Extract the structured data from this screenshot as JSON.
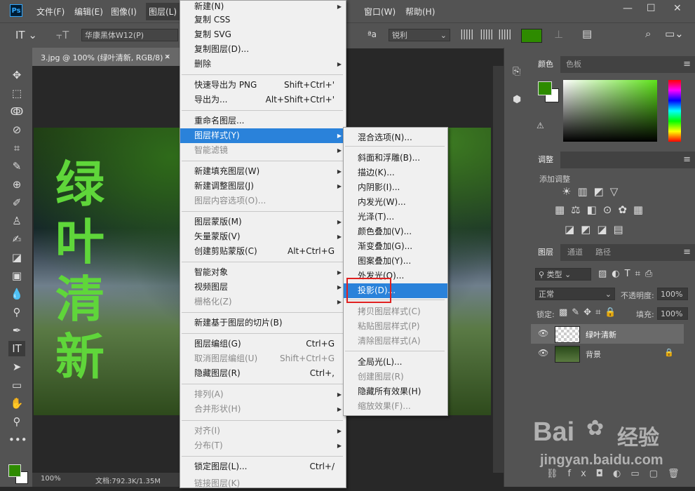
{
  "app": {
    "logo": "Ps"
  },
  "menubar": {
    "items": [
      "文件(F)",
      "编辑(E)",
      "图像(I)",
      "图层(L)",
      "窗口(W)",
      "帮助(H)"
    ]
  },
  "window_controls": {
    "minimize": "—",
    "maximize": "☐",
    "close": "✕"
  },
  "options_bar": {
    "font_family": "华康黑体W12(P)",
    "aa_label": "a",
    "aa_value": "锐利",
    "color": "#2e8b00"
  },
  "document": {
    "tab_title": "3.jpg @ 100% (绿叶清新, RGB/8) *",
    "tab_close": "×",
    "canvas_text": "绿叶清新",
    "zoom": "100%",
    "doc_size": "文档:792.3K/1.35M"
  },
  "layer_menu": {
    "items": [
      {
        "label": "新建(N)",
        "shortcut": "",
        "submenu": true,
        "disabled": false
      },
      {
        "label": "复制 CSS",
        "shortcut": "",
        "submenu": false,
        "disabled": false
      },
      {
        "label": "复制 SVG",
        "shortcut": "",
        "submenu": false,
        "disabled": false
      },
      {
        "label": "复制图层(D)...",
        "shortcut": "",
        "submenu": false,
        "disabled": false
      },
      {
        "label": "删除",
        "shortcut": "",
        "submenu": true,
        "disabled": false
      },
      {
        "label": "快速导出为 PNG",
        "shortcut": "Shift+Ctrl+'",
        "submenu": false,
        "disabled": false
      },
      {
        "label": "导出为...",
        "shortcut": "Alt+Shift+Ctrl+'",
        "submenu": false,
        "disabled": false
      },
      {
        "label": "重命名图层...",
        "shortcut": "",
        "submenu": false,
        "disabled": false
      },
      {
        "label": "图层样式(Y)",
        "shortcut": "",
        "submenu": true,
        "disabled": false
      },
      {
        "label": "智能滤镜",
        "shortcut": "",
        "submenu": true,
        "disabled": true
      },
      {
        "label": "新建填充图层(W)",
        "shortcut": "",
        "submenu": true,
        "disabled": false
      },
      {
        "label": "新建调整图层(J)",
        "shortcut": "",
        "submenu": true,
        "disabled": false
      },
      {
        "label": "图层内容选项(O)...",
        "shortcut": "",
        "submenu": false,
        "disabled": true
      },
      {
        "label": "图层蒙版(M)",
        "shortcut": "",
        "submenu": true,
        "disabled": false
      },
      {
        "label": "矢量蒙版(V)",
        "shortcut": "",
        "submenu": true,
        "disabled": false
      },
      {
        "label": "创建剪贴蒙版(C)",
        "shortcut": "Alt+Ctrl+G",
        "submenu": false,
        "disabled": false
      },
      {
        "label": "智能对象",
        "shortcut": "",
        "submenu": true,
        "disabled": false
      },
      {
        "label": "视频图层",
        "shortcut": "",
        "submenu": true,
        "disabled": false
      },
      {
        "label": "栅格化(Z)",
        "shortcut": "",
        "submenu": true,
        "disabled": true
      },
      {
        "label": "新建基于图层的切片(B)",
        "shortcut": "",
        "submenu": false,
        "disabled": false
      },
      {
        "label": "图层编组(G)",
        "shortcut": "Ctrl+G",
        "submenu": false,
        "disabled": false
      },
      {
        "label": "取消图层编组(U)",
        "shortcut": "Shift+Ctrl+G",
        "submenu": false,
        "disabled": true
      },
      {
        "label": "隐藏图层(R)",
        "shortcut": "Ctrl+,",
        "submenu": false,
        "disabled": false
      },
      {
        "label": "排列(A)",
        "shortcut": "",
        "submenu": true,
        "disabled": true
      },
      {
        "label": "合并形状(H)",
        "shortcut": "",
        "submenu": true,
        "disabled": true
      },
      {
        "label": "对齐(I)",
        "shortcut": "",
        "submenu": true,
        "disabled": true
      },
      {
        "label": "分布(T)",
        "shortcut": "",
        "submenu": true,
        "disabled": true
      },
      {
        "label": "锁定图层(L)...",
        "shortcut": "Ctrl+/",
        "submenu": false,
        "disabled": false
      },
      {
        "label": "链接图层(K)",
        "shortcut": "",
        "submenu": false,
        "disabled": true
      }
    ]
  },
  "style_submenu": {
    "items": [
      {
        "label": "混合选项(N)...",
        "disabled": false
      },
      {
        "label": "斜面和浮雕(B)...",
        "disabled": false
      },
      {
        "label": "描边(K)...",
        "disabled": false
      },
      {
        "label": "内阴影(I)...",
        "disabled": false
      },
      {
        "label": "内发光(W)...",
        "disabled": false
      },
      {
        "label": "光泽(T)...",
        "disabled": false
      },
      {
        "label": "颜色叠加(V)...",
        "disabled": false
      },
      {
        "label": "渐变叠加(G)...",
        "disabled": false
      },
      {
        "label": "图案叠加(Y)...",
        "disabled": false
      },
      {
        "label": "外发光(O)...",
        "disabled": false
      },
      {
        "label": "投影(D)...",
        "disabled": false
      },
      {
        "label": "拷贝图层样式(C)",
        "disabled": true
      },
      {
        "label": "粘贴图层样式(P)",
        "disabled": true
      },
      {
        "label": "清除图层样式(A)",
        "disabled": true
      },
      {
        "label": "全局光(L)...",
        "disabled": false
      },
      {
        "label": "创建图层(R)",
        "disabled": true
      },
      {
        "label": "隐藏所有效果(H)",
        "disabled": false
      },
      {
        "label": "缩放效果(F)...",
        "disabled": true
      }
    ]
  },
  "color_panel": {
    "tabs": [
      "颜色",
      "色板"
    ],
    "foreground": "#2e8b00",
    "background": "#ffffff"
  },
  "adjustments_panel": {
    "title": "调整",
    "subtitle": "添加调整"
  },
  "layers_panel": {
    "tabs": [
      "图层",
      "通道",
      "路径"
    ],
    "filter": "类型",
    "blend_mode": "正常",
    "opacity_label": "不透明度:",
    "opacity_value": "100%",
    "lock_label": "锁定:",
    "fill_label": "填充:",
    "fill_value": "100%",
    "layers": [
      {
        "name": "绿叶清新",
        "selected": true
      },
      {
        "name": "背景",
        "selected": false
      }
    ]
  },
  "watermark": {
    "brand": "Bai",
    "brand2": "经验",
    "url": "jingyan.baidu.com"
  }
}
